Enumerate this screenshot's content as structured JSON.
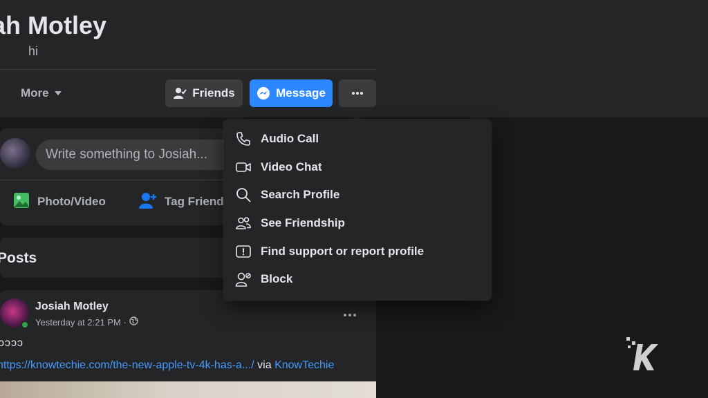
{
  "profile": {
    "name": "ah Motley",
    "bio": "hi"
  },
  "nav": {
    "more_label": "More"
  },
  "actions": {
    "friends_label": "Friends",
    "message_label": "Message",
    "more_options_icon": "ellipsis-icon"
  },
  "composer": {
    "placeholder": "Write something to Josiah...",
    "photo_label": "Photo/Video",
    "tag_label": "Tag Friends"
  },
  "posts": {
    "title": "Posts"
  },
  "post": {
    "author": "Josiah Motley",
    "timestamp": "Yesterday at 2:21 PM ·",
    "text": "ↄↄↄↄ",
    "link_text": "https://knowtechie.com/the-new-apple-tv-4k-has-a.../",
    "via_text": "via",
    "via_link": "KnowTechie"
  },
  "menu": {
    "items": [
      {
        "label": "Audio Call",
        "icon": "phone-icon"
      },
      {
        "label": "Video Chat",
        "icon": "video-icon"
      },
      {
        "label": "Search Profile",
        "icon": "search-icon"
      },
      {
        "label": "See Friendship",
        "icon": "friends-icon"
      },
      {
        "label": "Find support or report profile",
        "icon": "report-icon"
      },
      {
        "label": "Block",
        "icon": "block-user-icon"
      }
    ]
  },
  "colors": {
    "accent": "#2d88ff",
    "link": "#4599ff",
    "surface": "#242526",
    "background": "#18191a"
  }
}
